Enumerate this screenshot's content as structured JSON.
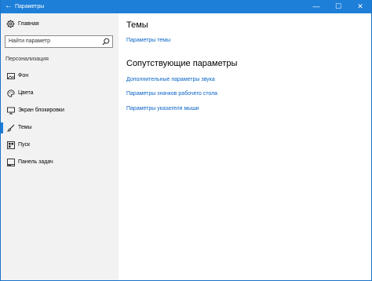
{
  "window": {
    "title": "Параметры",
    "minimize": "—",
    "maximize": "☐",
    "close": "✕"
  },
  "sidebar": {
    "home_label": "Главная",
    "search_placeholder": "Найти параметр",
    "section_title": "Персонализация",
    "items": [
      {
        "label": "Фон",
        "icon": "image-icon"
      },
      {
        "label": "Цвета",
        "icon": "palette-icon"
      },
      {
        "label": "Экран блокировки",
        "icon": "monitor-icon"
      },
      {
        "label": "Темы",
        "icon": "brush-icon",
        "selected": true
      },
      {
        "label": "Пуск",
        "icon": "start-icon"
      },
      {
        "label": "Панель задач",
        "icon": "taskbar-icon"
      }
    ]
  },
  "main": {
    "title": "Темы",
    "theme_settings_link": "Параметры темы",
    "related_title": "Сопутствующие параметры",
    "related_links": [
      "Дополнительные параметры звука",
      "Параметры значков рабочего стола",
      "Параметры указателя мыши"
    ]
  },
  "colors": {
    "accent": "#1e7fd8",
    "link": "#0a64c8",
    "sidebar_bg": "#f2f2f2"
  }
}
